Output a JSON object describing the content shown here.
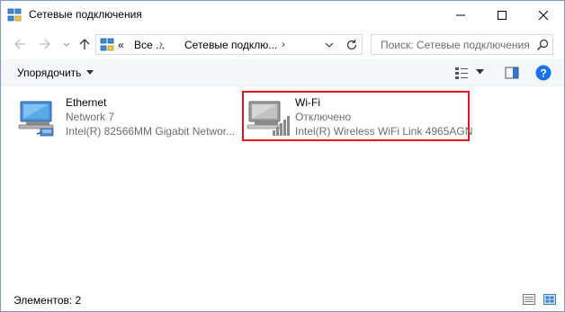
{
  "window": {
    "title": "Сетевые подключения",
    "minimize_icon": "minimize-icon",
    "maximize_icon": "maximize-icon",
    "close_icon": "close-icon"
  },
  "navigation": {
    "back_icon": "arrow-left-icon",
    "forward_icon": "arrow-right-icon",
    "recent_icon": "chevron-down-icon",
    "up_icon": "arrow-up-icon"
  },
  "address": {
    "prefix": "«",
    "crumbs": [
      "Все ...",
      "Сетевые подклю..."
    ],
    "separator": "›",
    "refresh_icon": "refresh-icon"
  },
  "search": {
    "placeholder": "Поиск: Сетевые подключения",
    "icon": "search-icon"
  },
  "toolbar": {
    "organize_label": "Упорядочить",
    "view_icon": "view-options-icon",
    "preview_icon": "preview-pane-icon",
    "help_icon": "help-icon"
  },
  "connections": [
    {
      "name": "Ethernet",
      "status": "Network  7",
      "device": "Intel(R) 82566MM Gigabit Networ...",
      "icon": "ethernet-adapter-icon"
    },
    {
      "name": "Wi-Fi",
      "status": "Отключено",
      "device": "Intel(R) Wireless WiFi Link 4965AGN",
      "icon": "wifi-adapter-disabled-icon",
      "selected": true
    }
  ],
  "statusbar": {
    "items_label": "Элементов: 2",
    "details_icon": "details-view-icon",
    "tiles_icon": "tiles-view-icon"
  },
  "colors": {
    "selection_border": "#e81123",
    "help_blue": "#1a73e8",
    "secondary_text": "#6d6d6d"
  }
}
